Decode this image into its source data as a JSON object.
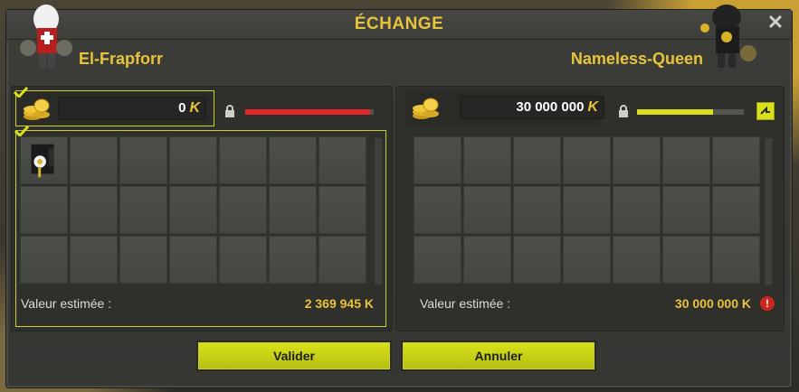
{
  "window": {
    "title": "ÉCHANGE",
    "close_label": "✕"
  },
  "left_player": {
    "name": "El-Frapforr",
    "kamas": "0",
    "kamas_symbol": "K",
    "value_label": "Valeur estimée :",
    "value_amount": "2 369 945 K",
    "bar_fill": 0.97,
    "bar_color": "#e02828",
    "validated": true
  },
  "right_player": {
    "name": "Nameless-Queen",
    "kamas": "30 000 000",
    "kamas_symbol": "K",
    "value_label": "Valeur estimée :",
    "value_amount": "30 000 000 K",
    "warning_glyph": "!",
    "bar_fill": 0.71,
    "bar_color": "#d7e01b",
    "validated": false
  },
  "buttons": {
    "validate": "Valider",
    "cancel": "Annuler"
  },
  "colors": {
    "accent": "#e8c43b",
    "highlight": "#c9d12a",
    "button": "#d8e21a",
    "warning": "#d0241c"
  },
  "icons": [
    "coin-stack-icon",
    "lock-icon",
    "check-icon",
    "close-icon",
    "warning-icon",
    "kamas-icon",
    "toggle-icon"
  ]
}
